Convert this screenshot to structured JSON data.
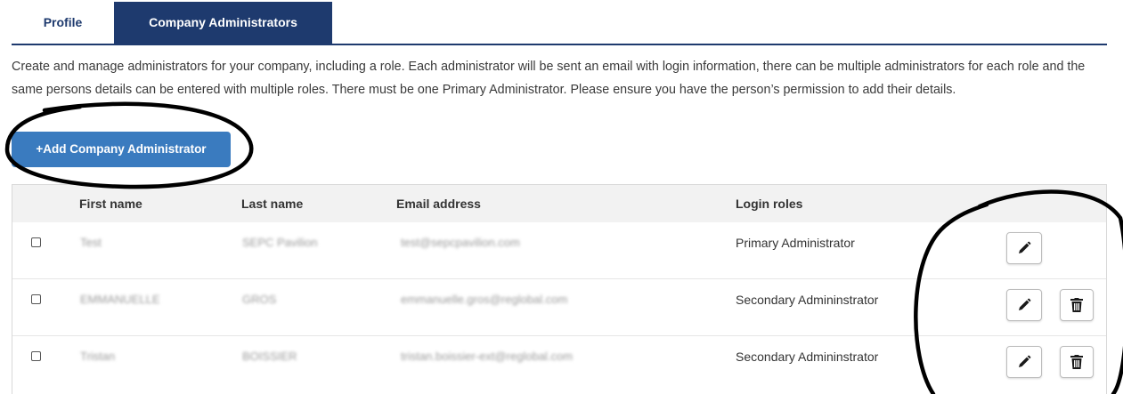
{
  "tabs": [
    {
      "label": "Profile",
      "active": false
    },
    {
      "label": "Company Administrators",
      "active": true
    }
  ],
  "description": "Create and manage administrators for your company, including a role. Each administrator will be sent an email with login information, there can be multiple administrators for each role and the same persons details can be entered with multiple roles. There must be one Primary Administrator. Please ensure you have the person’s permission to add their details.",
  "add_button_label": "+Add Company Administrator",
  "table": {
    "headers": {
      "first_name": "First name",
      "last_name": "Last name",
      "email": "Email address",
      "roles": "Login roles"
    },
    "rows": [
      {
        "first_name": "Test",
        "last_name": "SEPC Pavilion",
        "email": "test@sepcpavilion.com",
        "role": "Primary Administrator",
        "can_delete": false
      },
      {
        "first_name": "EMMANUELLE",
        "last_name": "GROS",
        "email": "emmanuelle.gros@reglobal.com",
        "role": "Secondary Admininstrator",
        "can_delete": true
      },
      {
        "first_name": "Tristan",
        "last_name": "BOISSIER",
        "email": "tristan.boissier-ext@reglobal.com",
        "role": "Secondary Admininstrator",
        "can_delete": true
      }
    ]
  },
  "colors": {
    "brand_navy": "#1e3a6e",
    "button_blue": "#3a7bbf",
    "header_bg": "#f2f2f2"
  },
  "icons": {
    "edit": "pencil-icon",
    "delete": "trash-icon"
  }
}
